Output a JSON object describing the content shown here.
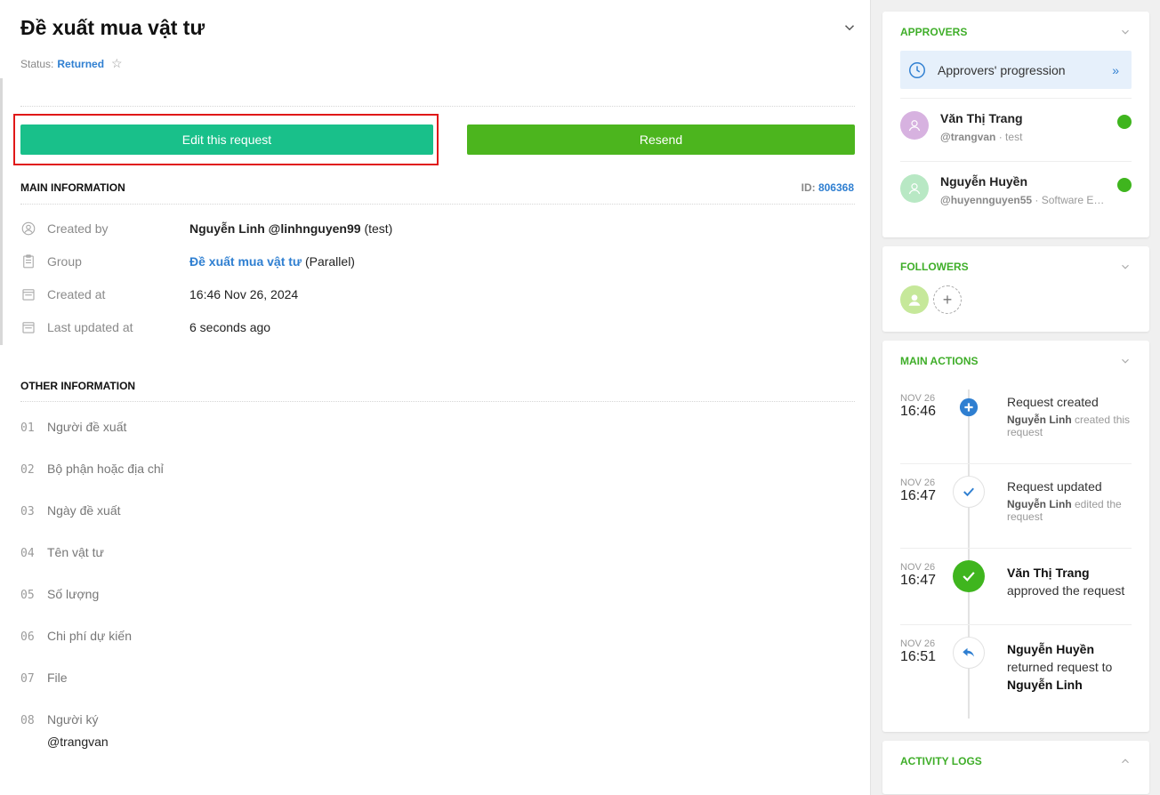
{
  "header": {
    "title": "Đề xuất mua vật tư",
    "status_label": "Status:",
    "status_value": "Returned"
  },
  "buttons": {
    "edit": "Edit this request",
    "resend": "Resend"
  },
  "main_info": {
    "title": "MAIN INFORMATION",
    "id_label": "ID:",
    "id_value": "806368",
    "rows": [
      {
        "label": "Created by",
        "value_bold": "Nguyễn Linh @linhnguyen99",
        "value_suffix": " (test)"
      },
      {
        "label": "Group",
        "value_link": "Đề xuất mua vật tư",
        "value_suffix": " (Parallel)"
      },
      {
        "label": "Created at",
        "value": "16:46 Nov 26, 2024"
      },
      {
        "label": "Last updated at",
        "value": "6 seconds ago"
      }
    ]
  },
  "other_info": {
    "title": "OTHER INFORMATION",
    "fields": [
      {
        "num": "01",
        "label": "Người đề xuất"
      },
      {
        "num": "02",
        "label": "Bộ phận hoặc địa chỉ"
      },
      {
        "num": "03",
        "label": "Ngày đề xuất"
      },
      {
        "num": "04",
        "label": "Tên vật tư"
      },
      {
        "num": "05",
        "label": "Số lượng"
      },
      {
        "num": "06",
        "label": "Chi phí dự kiến"
      },
      {
        "num": "07",
        "label": "File"
      },
      {
        "num": "08",
        "label": "Người ký",
        "value": "@trangvan"
      }
    ]
  },
  "approvers": {
    "title": "APPROVERS",
    "progression_label": "Approvers' progression",
    "progression_arrow": "»",
    "list": [
      {
        "name": "Văn Thị Trang",
        "handle": "@trangvan",
        "detail": " · test",
        "avatar_color": "#d7b2e0"
      },
      {
        "name": "Nguyễn Huyền",
        "handle": "@huyennguyen55",
        "detail": " · Software Eng...",
        "avatar_color": "#b8e8c4"
      }
    ],
    "status_color": "#3fb51e"
  },
  "followers": {
    "title": "FOLLOWERS",
    "add_symbol": "+"
  },
  "main_actions": {
    "title": "MAIN ACTIONS",
    "items": [
      {
        "date": "NOV 26",
        "time": "16:46",
        "title": "Request created",
        "actor": "Nguyễn Linh",
        "desc": " created this request"
      },
      {
        "date": "NOV 26",
        "time": "16:47",
        "title": "Request updated",
        "actor": "Nguyễn Linh",
        "desc": " edited the request"
      },
      {
        "date": "NOV 26",
        "time": "16:47",
        "actor": "Văn Thị Trang",
        "desc": "approved the request"
      },
      {
        "date": "NOV 26",
        "time": "16:51",
        "actor": "Nguyễn Huyền",
        "desc": "returned request to",
        "target": "Nguyễn Linh"
      }
    ]
  },
  "activity_logs": {
    "title": "ACTIVITY LOGS"
  },
  "colors": {
    "accent_green": "#3fae29",
    "edit_button": "#19c08a",
    "resend_button": "#4cb51e",
    "link_blue": "#2f7fd1",
    "highlight_red": "#e01818"
  },
  "icons": {
    "created_by": "user-circle-icon",
    "group": "clipboard-icon",
    "created_at": "calendar-icon",
    "last_updated": "calendar-icon",
    "favorite": "star-icon",
    "progression": "clock-icon"
  }
}
